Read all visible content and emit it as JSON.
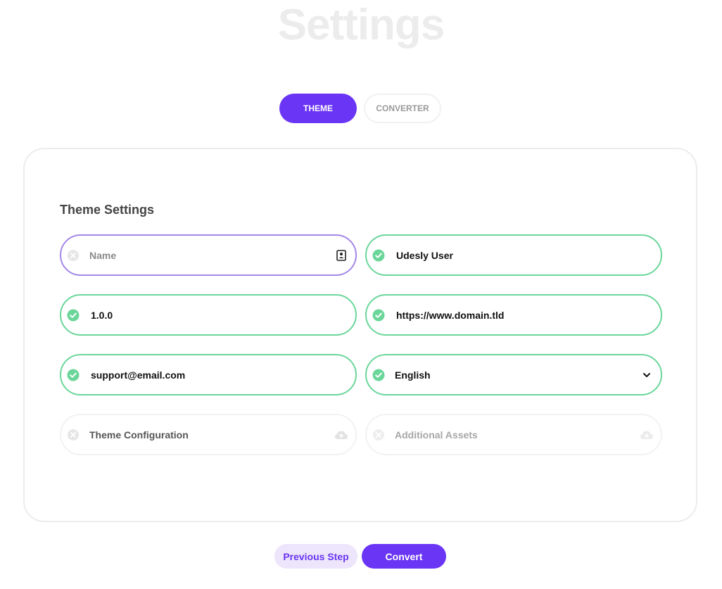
{
  "page": {
    "title": "Settings"
  },
  "tabs": [
    {
      "label": "THEME",
      "active": true
    },
    {
      "label": "CONVERTER",
      "active": false
    }
  ],
  "card": {
    "title": "Theme Settings"
  },
  "fields": {
    "name": {
      "placeholder": "Name",
      "value": "",
      "status": "empty"
    },
    "author": {
      "value": "Udesly User",
      "status": "valid"
    },
    "version": {
      "value": "1.0.0",
      "status": "valid"
    },
    "website": {
      "value": "https://www.domain.tld",
      "status": "valid"
    },
    "email": {
      "value": "support@email.com",
      "status": "valid"
    },
    "language": {
      "value": "English",
      "status": "valid",
      "options": [
        "English"
      ]
    },
    "theme_configuration": {
      "label": "Theme Configuration",
      "status": "empty"
    },
    "additional_assets": {
      "label": "Additional Assets",
      "status": "empty"
    }
  },
  "footer": {
    "previous_label": "Previous Step",
    "convert_label": "Convert"
  },
  "colors": {
    "accent": "#6a35f4",
    "accent_light": "#ece5fb",
    "valid": "#6bd69a",
    "focus": "#a387ea",
    "muted_border": "#f2f2f2"
  },
  "icons": {
    "valid": "check-circle-icon",
    "empty": "x-circle-icon",
    "contact": "contact-card-icon",
    "dropdown": "chevron-down-icon",
    "upload": "cloud-upload-icon"
  }
}
